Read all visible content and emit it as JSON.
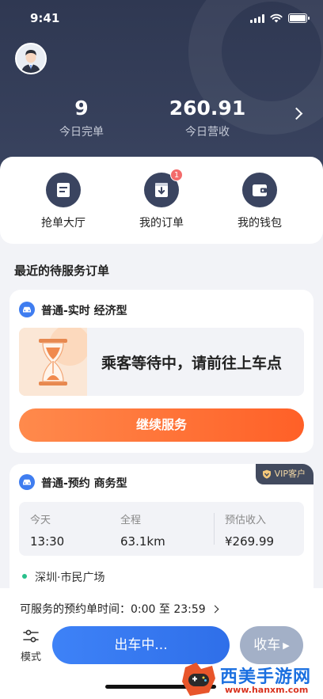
{
  "status_bar": {
    "time": "9:41"
  },
  "stats": [
    {
      "value": "9",
      "label": "今日完单"
    },
    {
      "value": "260.91",
      "label": "今日营收"
    }
  ],
  "quick_actions": [
    {
      "label": "抢单大厅",
      "icon": "order-hall-icon"
    },
    {
      "label": "我的订单",
      "icon": "my-orders-icon",
      "badge": "1"
    },
    {
      "label": "我的钱包",
      "icon": "wallet-icon"
    }
  ],
  "section_title": "最近的待服务订单",
  "order1": {
    "type": "普通-实时 经济型",
    "waiting_text": "乘客等待中，请前往上车点",
    "continue_label": "继续服务"
  },
  "order2": {
    "type": "普通-预约 商务型",
    "vip_label": "VIP客户",
    "day_label": "今天",
    "time": "13:30",
    "distance_label": "全程",
    "distance": "63.1km",
    "income_label": "预估收入",
    "income": "¥269.99",
    "location": "深圳·市民广场"
  },
  "bottom": {
    "schedule_text": "可服务的预约单时间：0:00 至 23:59",
    "mode_label": "模式",
    "depart_label": "出车中...",
    "stop_label": "收车"
  },
  "watermark": {
    "name": "西美手游网",
    "url": "www.hanxm.com"
  },
  "colors": {
    "header_bg": "#2f3852",
    "accent_orange": "#ff6a2b",
    "accent_blue": "#3e82f7",
    "badge_red": "#f36b6b"
  }
}
